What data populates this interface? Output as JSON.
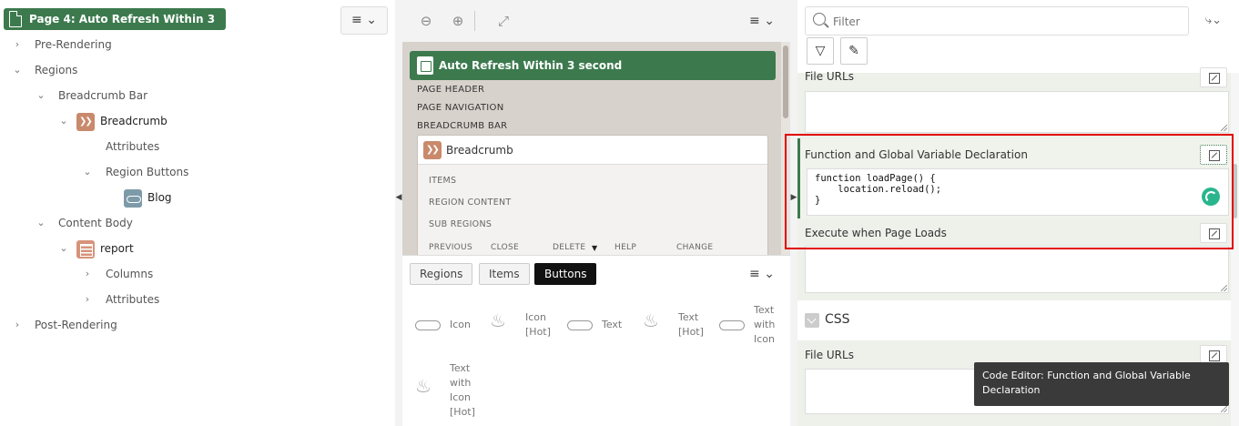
{
  "left_tree": {
    "page_node": "Page 4: Auto Refresh Within 3 second",
    "items": {
      "pre_rendering": "Pre-Rendering",
      "regions": "Regions",
      "breadcrumb_bar": "Breadcrumb Bar",
      "breadcrumb": "Breadcrumb",
      "attributes": "Attributes",
      "region_buttons": "Region Buttons",
      "blog": "Blog",
      "content_body": "Content Body",
      "report": "report",
      "columns": "Columns",
      "attributes2": "Attributes",
      "post_rendering": "Post-Rendering"
    }
  },
  "layout_canvas": {
    "page_title": "Auto Refresh Within 3 second",
    "positions": [
      "PAGE HEADER",
      "PAGE NAVIGATION",
      "BREADCRUMB BAR"
    ],
    "breadcrumb_region": "Breadcrumb",
    "sub_positions": [
      "ITEMS",
      "REGION CONTENT",
      "SUB REGIONS"
    ],
    "button_positions": [
      "PREVIOUS",
      "CLOSE",
      "DELETE",
      "HELP",
      "CHANGE"
    ]
  },
  "gallery": {
    "tabs": [
      "Regions",
      "Items",
      "Buttons"
    ],
    "active_tab": "Buttons",
    "items": [
      {
        "label": "Icon",
        "icon": "pill-icon"
      },
      {
        "label": "Icon [Hot]",
        "icon": "flame-icon"
      },
      {
        "label": "Text",
        "icon": "pill-icon"
      },
      {
        "label": "Text [Hot]",
        "icon": "flame-icon"
      },
      {
        "label": "Text with Icon",
        "icon": "pill-icon"
      },
      {
        "label": "Text with Icon [Hot]",
        "icon": "flame-icon"
      }
    ]
  },
  "property_editor": {
    "filter_placeholder": "Filter",
    "file_urls_label": "File URLs",
    "fgv_label": "Function and Global Variable Declaration",
    "code_lines": [
      "function loadPage() {",
      "    location.reload();",
      "}"
    ],
    "execute_label": "Execute when Page Loads",
    "css_group": "CSS",
    "css_file_urls": "File URLs",
    "tooltip": "Code Editor: Function and Global Variable Declaration"
  },
  "colors": {
    "accent": "#3c7a4e",
    "highlight": "#e00000",
    "spinner": "#2bb58f"
  }
}
